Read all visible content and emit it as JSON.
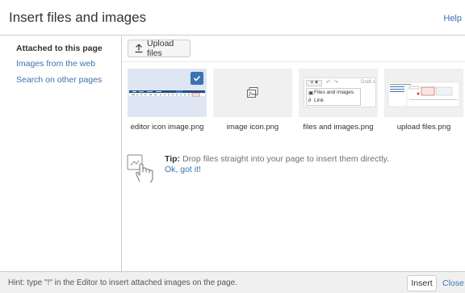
{
  "header": {
    "title": "Insert files and images",
    "help_label": "Help"
  },
  "sidebar": {
    "items": [
      {
        "label": "Attached to this page",
        "active": true
      },
      {
        "label": "Images from the web",
        "active": false
      },
      {
        "label": "Search on other pages",
        "active": false
      }
    ]
  },
  "main": {
    "upload_label": "Upload files",
    "tiles": [
      {
        "label": "editor icon image.png",
        "selected": true
      },
      {
        "label": "image icon.png",
        "selected": false
      },
      {
        "label": "files and images.png",
        "selected": false
      },
      {
        "label": "upload files.png",
        "selected": false
      }
    ],
    "thumb_files": {
      "menu_items": [
        "Files and images",
        "Link"
      ],
      "draft_text": "Draft s"
    },
    "tip": {
      "prefix": "Tip:",
      "text": " Drop files straight into your page to insert them directly.",
      "link": "Ok, got it!"
    }
  },
  "footer": {
    "hint": "Hint: type \"!\" in the Editor to insert attached images on the page.",
    "insert_label": "Insert",
    "close_label": "Close"
  },
  "colors": {
    "link": "#3b73af",
    "selected_tile": "#dde6f2",
    "tile_bg": "#f0f0f0",
    "footer_bg": "#f0f0f0"
  }
}
